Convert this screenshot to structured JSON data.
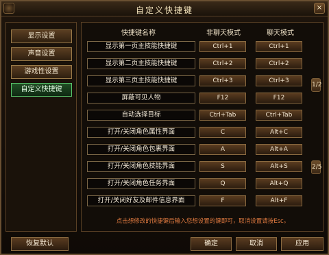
{
  "window": {
    "title": "自定义快捷键",
    "close_label": "×"
  },
  "sidebar": {
    "items": [
      {
        "label": "显示设置"
      },
      {
        "label": "声音设置"
      },
      {
        "label": "游戏性设置"
      },
      {
        "label": "自定义快捷键"
      }
    ]
  },
  "table": {
    "headers": [
      "快捷键名称",
      "非聊天模式",
      "聊天模式"
    ],
    "rows": [
      {
        "name": "显示第一页主技能快捷键",
        "normal": "Ctrl+1",
        "chat": "Ctrl+1"
      },
      {
        "name": "显示第二页主技能快捷键",
        "normal": "Ctrl+2",
        "chat": "Ctrl+2"
      },
      {
        "name": "显示第三页主技能快捷键",
        "normal": "Ctrl+3",
        "chat": "Ctrl+3"
      },
      {
        "name": "屏蔽可见人物",
        "normal": "F12",
        "chat": "F12"
      },
      {
        "name": "自动选择目标",
        "normal": "Ctrl+Tab",
        "chat": "Ctrl+Tab"
      },
      {
        "name": "打开/关闭角色属性界面",
        "normal": "C",
        "chat": "Alt+C"
      },
      {
        "name": "打开/关闭角色包裹界面",
        "normal": "A",
        "chat": "Alt+A"
      },
      {
        "name": "打开/关闭角色技能界面",
        "normal": "S",
        "chat": "Alt+S"
      },
      {
        "name": "打开/关闭角色任务界面",
        "normal": "Q",
        "chat": "Alt+Q"
      },
      {
        "name": "打开/关闭好友及邮件信息界面",
        "normal": "F",
        "chat": "Alt+F"
      }
    ],
    "hint": "点击想修改的快捷键后输入您想设置的键即可，取消设置请按Esc。"
  },
  "ornaments": {
    "upper": "1/2",
    "lower": "2/5"
  },
  "footer": {
    "reset": "恢复默认",
    "ok": "确定",
    "cancel": "取消",
    "apply": "应用"
  }
}
